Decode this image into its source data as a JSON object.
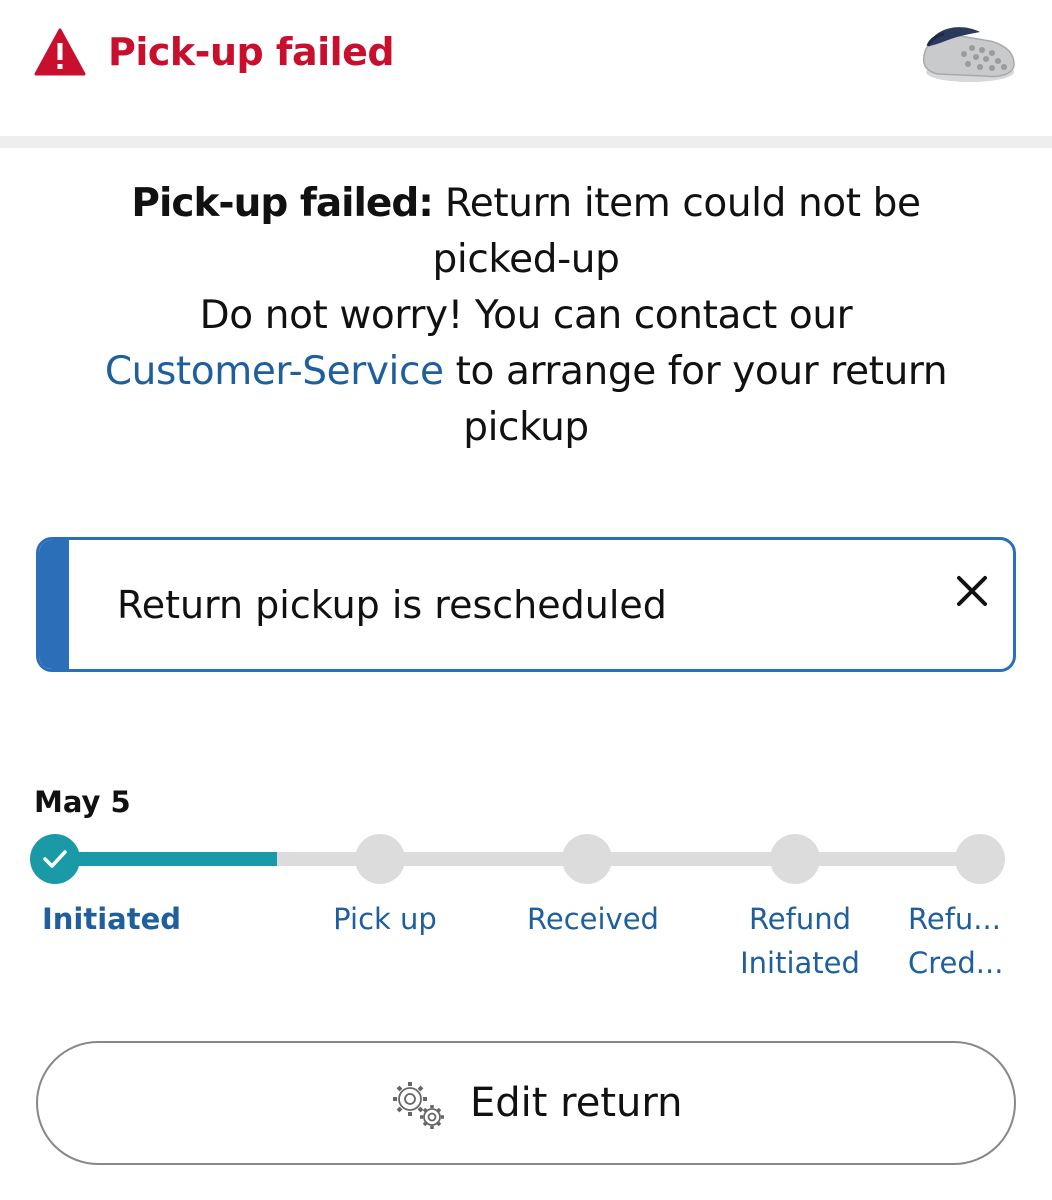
{
  "header": {
    "title": "Pick-up failed",
    "alert_color": "#c8102e",
    "warning_icon": "warning-triangle-icon",
    "product_image": "clog-shoe-thumbnail"
  },
  "message": {
    "bold_prefix": "Pick-up failed:",
    "line1_rest": "Return item could not be picked-up",
    "line2": "Do not worry! You can contact our",
    "link_text": "Customer-Service",
    "line3_rest": "to arrange for your return pickup"
  },
  "banner": {
    "text": "Return pickup is rescheduled",
    "accent": "#2a6fb8",
    "close_icon": "close-icon"
  },
  "tracker": {
    "date": "May 5",
    "progress": 0.24,
    "progress_color": "#1a9aa6",
    "steps": [
      {
        "label": "Initiated",
        "done": true
      },
      {
        "label": "Pick up",
        "done": false
      },
      {
        "label": "Received",
        "done": false
      },
      {
        "label": "Refund Initiated",
        "label_line1": "Refund",
        "label_line2": "Initiated",
        "done": false
      },
      {
        "label_line1": "Refu...",
        "label_line2": "Cred...",
        "done": false
      }
    ]
  },
  "edit_button": {
    "label": "Edit return",
    "icon": "gears-icon"
  }
}
